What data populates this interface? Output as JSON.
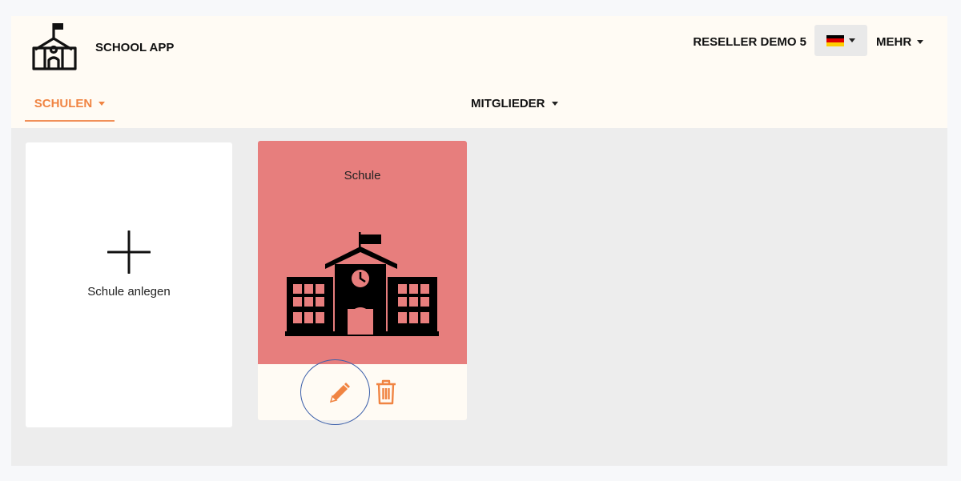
{
  "header": {
    "app_title": "SCHOOL APP",
    "user_name": "RESELLER DEMO 5",
    "language": {
      "flag": "de",
      "colors": [
        "#000000",
        "#dd0000",
        "#ffce00"
      ]
    },
    "more_label": "MEHR"
  },
  "nav": {
    "schulen_label": "SCHULEN",
    "mitglieder_label": "MITGLIEDER",
    "active": "SCHULEN"
  },
  "cards": {
    "add_label": "Schule anlegen",
    "school": {
      "name": "Schule",
      "background": "#e77e7d",
      "actions": [
        "edit",
        "delete"
      ]
    }
  },
  "colors": {
    "accent": "#f08442",
    "header_bg": "#fffbf4",
    "content_bg": "#ededed"
  },
  "icons": [
    "school-logo-icon",
    "caret-down-icon",
    "german-flag-icon",
    "plus-icon",
    "school-building-icon",
    "pencil-icon",
    "trash-icon"
  ]
}
